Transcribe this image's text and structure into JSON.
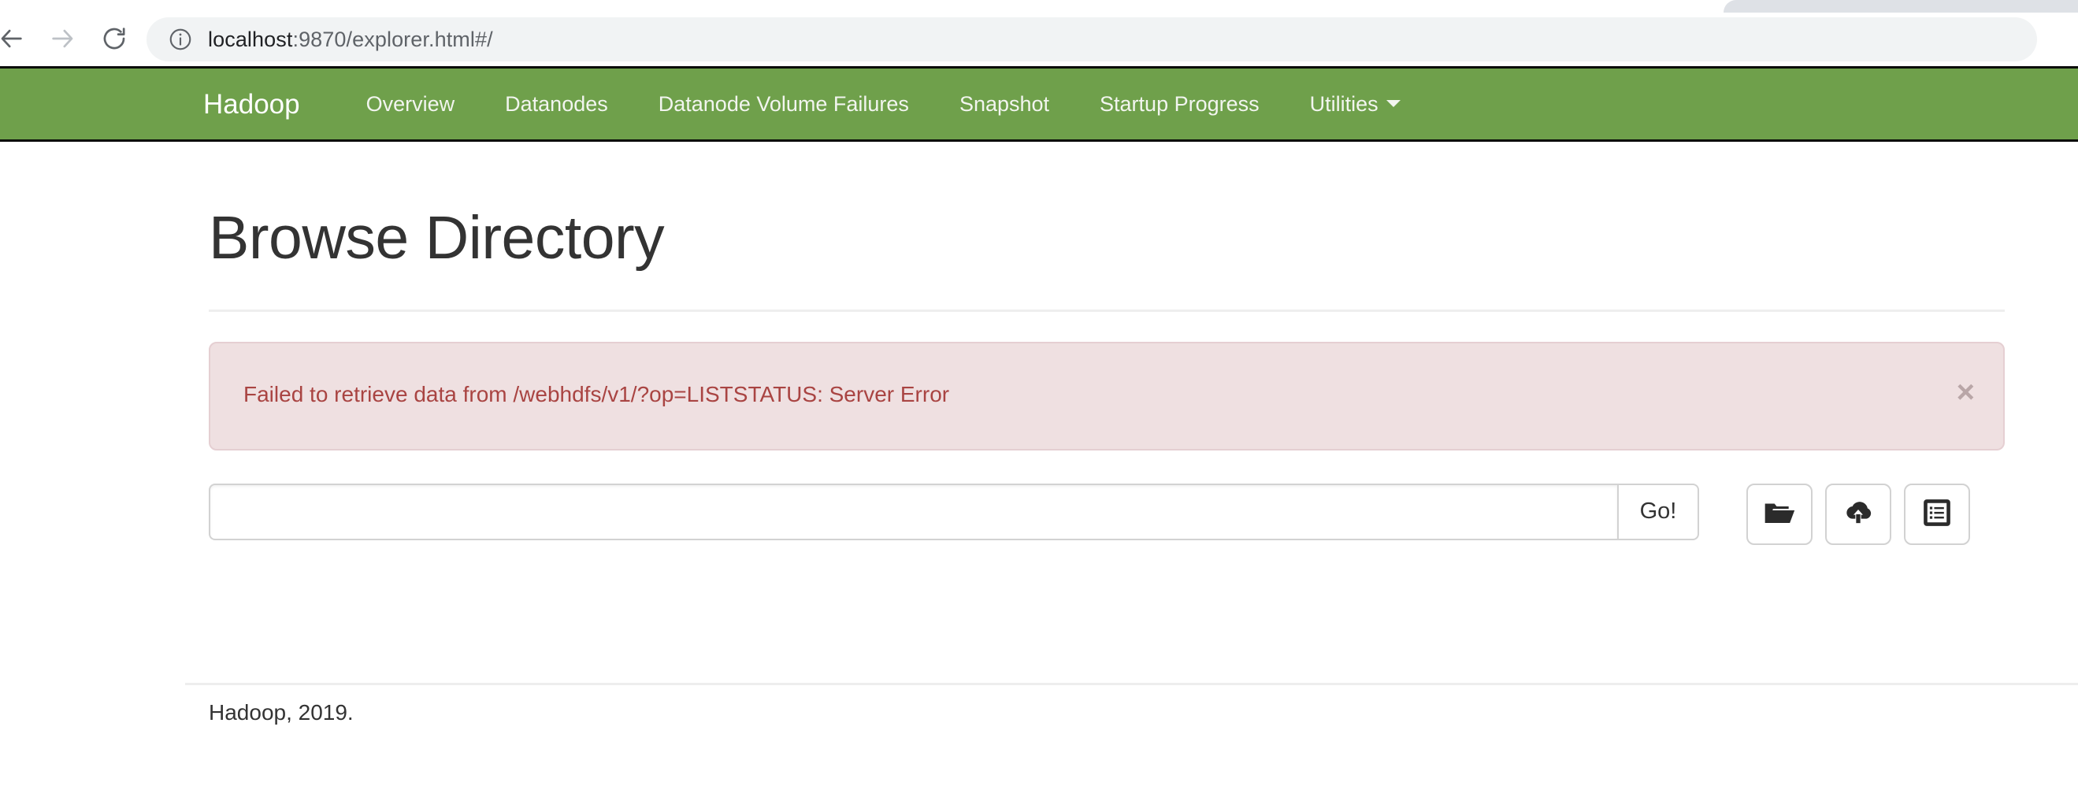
{
  "browser": {
    "back_label": "Back",
    "forward_label": "Forward",
    "reload_label": "Reload",
    "url_host": "localhost",
    "url_rest": ":9870/explorer.html#/",
    "site_info_label": "Site information"
  },
  "navbar": {
    "brand": "Hadoop",
    "links": [
      {
        "label": "Overview",
        "caret": false
      },
      {
        "label": "Datanodes",
        "caret": false
      },
      {
        "label": "Datanode Volume Failures",
        "caret": false
      },
      {
        "label": "Snapshot",
        "caret": false
      },
      {
        "label": "Startup Progress",
        "caret": false
      },
      {
        "label": "Utilities",
        "caret": true
      }
    ],
    "background_color": "#6FA04B"
  },
  "main": {
    "title": "Browse Directory",
    "alert": {
      "message": "Failed to retrieve data from /webhdfs/v1/?op=LISTSTATUS: Server Error",
      "close_label": "×",
      "text_color": "#a94442",
      "background_color": "#efe0e1"
    },
    "path_input": {
      "value": "",
      "placeholder": ""
    },
    "go_button_label": "Go!",
    "action_buttons": [
      {
        "icon": "folder-open-icon",
        "title": "Create Directory"
      },
      {
        "icon": "cloud-upload-icon",
        "title": "Upload Files"
      },
      {
        "icon": "list-alt-icon",
        "title": "Cut & Paste"
      }
    ]
  },
  "footer": {
    "text": "Hadoop, 2019."
  }
}
